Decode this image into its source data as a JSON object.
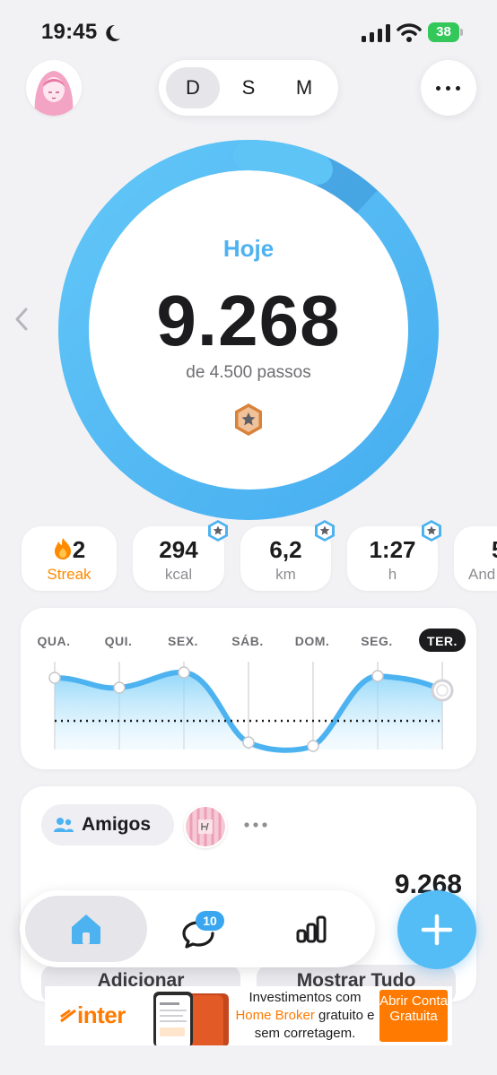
{
  "status_bar": {
    "time": "19:45",
    "battery": "38"
  },
  "range_selector": {
    "options": [
      "D",
      "S",
      "M"
    ],
    "selected": "D"
  },
  "progress": {
    "label": "Hoje",
    "value": "9.268",
    "goal_text": "de 4.500 passos",
    "fraction_of_goal": 2.06
  },
  "stats": {
    "streak": {
      "value": "2",
      "label": "Streak"
    },
    "calories": {
      "value": "294",
      "unit": "kcal"
    },
    "distance": {
      "value": "6,2",
      "unit": "km"
    },
    "duration": {
      "value": "1:27",
      "unit": "h"
    },
    "partial": {
      "value": "5",
      "unit": "And"
    }
  },
  "week": {
    "days": [
      "QUA.",
      "QUI.",
      "SEX.",
      "SÁB.",
      "DOM.",
      "SEG.",
      "TER."
    ],
    "today_index": 6
  },
  "friends": {
    "tab_label": "Amigos",
    "steps": "9.268",
    "add_label": "Adicionar",
    "show_all_label": "Mostrar Tudo"
  },
  "tabbar": {
    "chat_badge": "10"
  },
  "ad": {
    "brand": "inter",
    "line1": "Investimentos com",
    "highlight": "Home Broker",
    "line2": "gratuito e",
    "line3": "sem corretagem.",
    "cta": "Abrir Conta Gratuita"
  },
  "colors": {
    "accent": "#4db2f0",
    "streak": "#ff8a00",
    "ad_brand": "#ff7a00"
  }
}
